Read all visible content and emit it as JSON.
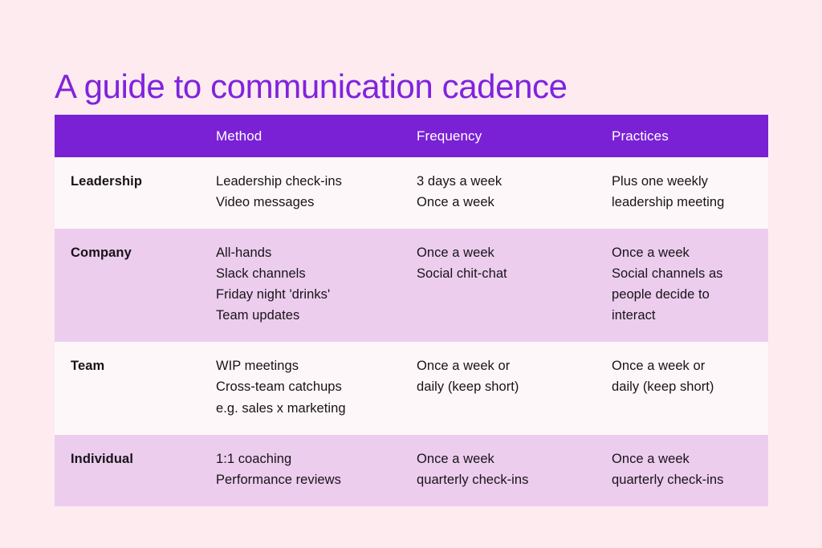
{
  "page": {
    "title": "A guide to communication cadence",
    "background_color": "#fdebf0",
    "title_color": "#8023dd"
  },
  "table": {
    "header_background": "#7a21d6",
    "header_text_color": "#ffffff",
    "row_odd_background": "#fdf7f9",
    "row_even_background": "#eccdee",
    "columns": [
      "",
      "Method",
      "Frequency",
      "Practices"
    ],
    "rows": [
      {
        "label": "Leadership",
        "method": [
          "Leadership check-ins",
          "Video messages"
        ],
        "frequency": [
          "3 days a week",
          "Once a week"
        ],
        "practices": [
          "Plus one weekly",
          "leadership meeting"
        ]
      },
      {
        "label": "Company",
        "method": [
          "All-hands",
          "Slack channels",
          "Friday night 'drinks'",
          "Team updates"
        ],
        "frequency": [
          "Once a week",
          "Social chit-chat"
        ],
        "practices": [
          "Once a week",
          "Social channels as",
          "people decide to",
          "interact"
        ]
      },
      {
        "label": "Team",
        "method": [
          "WIP meetings",
          "Cross-team catchups",
          "e.g. sales x marketing"
        ],
        "frequency": [
          "Once a week or",
          "daily (keep short)"
        ],
        "practices": [
          "Once a week or",
          "daily (keep short)"
        ]
      },
      {
        "label": "Individual",
        "method": [
          "1:1 coaching",
          "Performance reviews"
        ],
        "frequency": [
          "Once a week",
          "quarterly check-ins"
        ],
        "practices": [
          "Once a week",
          "quarterly check-ins"
        ]
      }
    ]
  }
}
